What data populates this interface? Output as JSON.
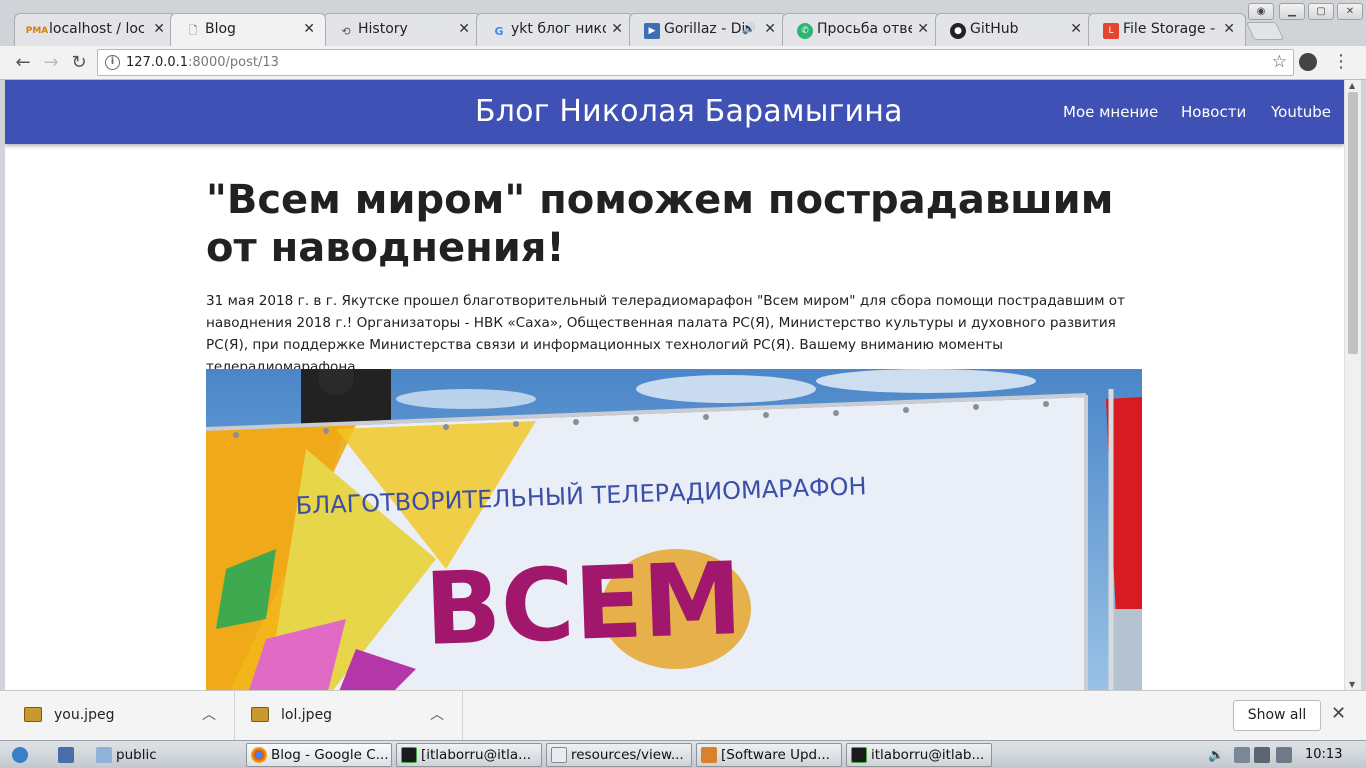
{
  "browser": {
    "tabs": [
      {
        "label": "localhost / loc",
        "active": false
      },
      {
        "label": "Blog",
        "active": true
      },
      {
        "label": "History",
        "active": false
      },
      {
        "label": "ykt блог нико",
        "active": false
      },
      {
        "label": "Gorillaz - Di",
        "active": false
      },
      {
        "label": "Просьба отве",
        "active": false
      },
      {
        "label": "GitHub",
        "active": false
      },
      {
        "label": "File Storage -",
        "active": false
      }
    ],
    "url_host": "127.0.0.1",
    "url_rest": ":8000/post/13"
  },
  "site": {
    "brand": "Блог Николая Барамыгина",
    "nav": [
      "Мое мнение",
      "Новости",
      "Youtube"
    ],
    "nav_color": "#3f51b5"
  },
  "post": {
    "title": "\"Всем миром\" поможем пострадавшим от наводнения!",
    "body": "31 мая 2018 г. в г. Якутске прошел благотворительный телерадиомарафон \"Всем миром\" для сбора помощи пострадавшим от наводнения 2018 г.! Организаторы - НВК «Саха», Общественная палата РС(Я), Министерство культуры и духовного развития РС(Я), при поддержке Министерства связи и информационных технологий РС(Я). Вашему вниманию моменты телерадиомарафона.",
    "photo": {
      "banner_line": "БЛАГОТВОРИТЕЛЬНЫЙ ТЕЛЕРАДИОМАРАФОН",
      "banner_big": "ВСЕМ"
    }
  },
  "downloads": {
    "items": [
      "you.jpeg",
      "lol.jpeg"
    ],
    "show_all": "Show all"
  },
  "taskbar": {
    "items": [
      "public",
      "Blog - Google C...",
      "[itlaborru@itla...",
      "resources/view...",
      "[Software Upd...",
      "itlaborru@itlab..."
    ],
    "clock": "10:13"
  }
}
